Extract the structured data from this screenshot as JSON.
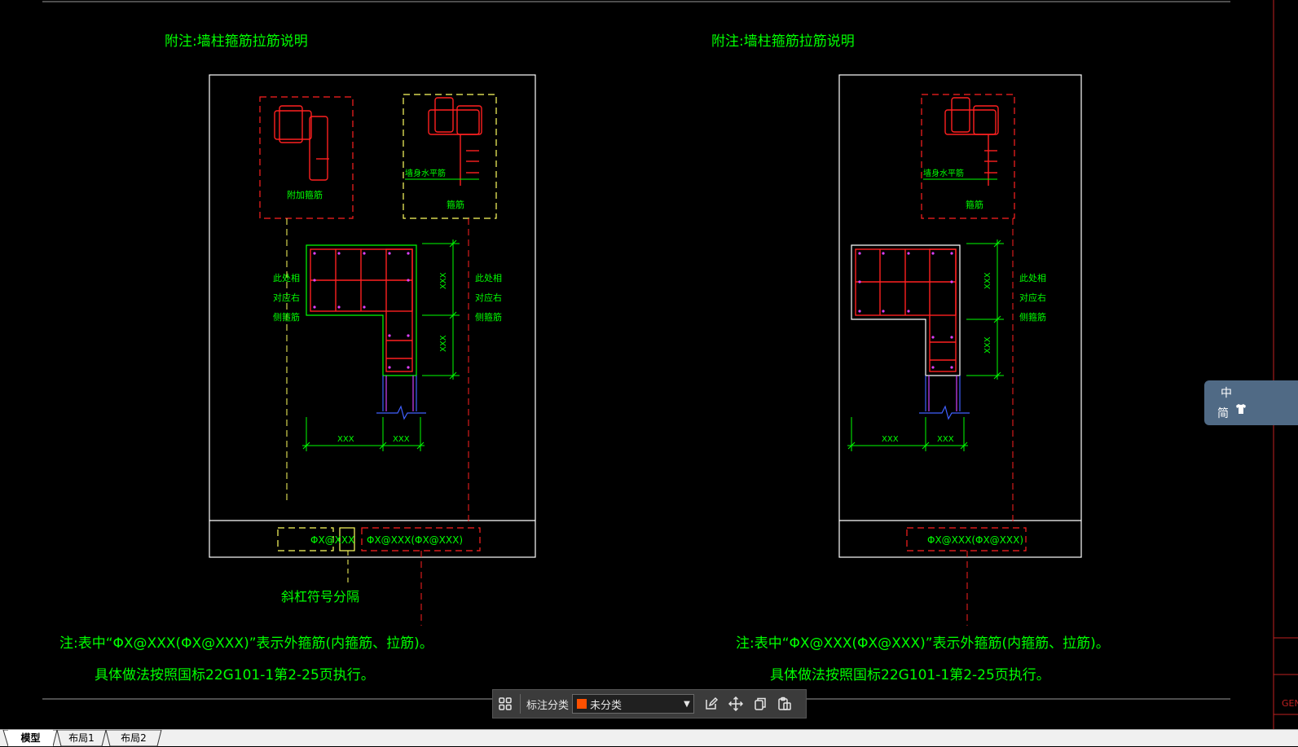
{
  "drawing": {
    "panel_left": {
      "title": "附注:墙柱箍筋拉筋说明",
      "detail_add_label": "附加箍筋",
      "detail_wall_label": "墙身水平筋",
      "detail_stirrup_label": "箍筋",
      "side_note_lines": [
        "此处相",
        "对应右",
        "侧箍筋"
      ],
      "dim_vertical": [
        "XXX",
        "XXX"
      ],
      "dim_horizontal": [
        "XXX",
        "XXX"
      ],
      "table_cell_1": "ΦX@XXX",
      "table_cell_2": "ΦX@XXX(ΦX@XXX)",
      "leader_note": "斜杠符号分隔",
      "note_line_1": "注:表中“ΦX@XXX(ΦX@XXX)”表示外箍筋(内箍筋、拉筋)。",
      "note_line_2": "具体做法按照国标22G101-1第2-25页执行。"
    },
    "panel_right": {
      "title": "附注:墙柱箍筋拉筋说明",
      "detail_wall_label": "墙身水平筋",
      "detail_stirrup_label": "箍筋",
      "side_note_lines": [
        "此处相",
        "对应右",
        "侧箍筋"
      ],
      "dim_vertical": [
        "XXX",
        "XXX"
      ],
      "dim_horizontal": [
        "XXX",
        "XXX"
      ],
      "table_cell": "ΦX@XXX(ΦX@XXX)",
      "note_line_1": "注:表中“ΦX@XXX(ΦX@XXX)”表示外箍筋(内箍筋、拉筋)。",
      "note_line_2": "具体做法按照国标22G101-1第2-25页执行。"
    },
    "edge_text": "GEN",
    "colors": {
      "background": "#000000",
      "annotation_green": "#00ff00",
      "rebar_red": "#ff2020",
      "outline_white": "#ffffff",
      "dash_yellow": "#ffff60",
      "purple": "#d040ff",
      "blue": "#4060ff"
    }
  },
  "toolbar": {
    "grid_icon": "grid-view-icon",
    "label": "标注分类",
    "select_value": "未分类",
    "select_color": "#ff5000",
    "edit_icon": "edit-icon",
    "move_icon": "move-icon",
    "copy_icon": "copy-icon",
    "paste_icon": "paste-icon"
  },
  "tabs": [
    "模型",
    "布局1",
    "布局2"
  ],
  "ime": {
    "mode": "中",
    "charset": "简",
    "skin_icon": "tshirt-icon"
  }
}
